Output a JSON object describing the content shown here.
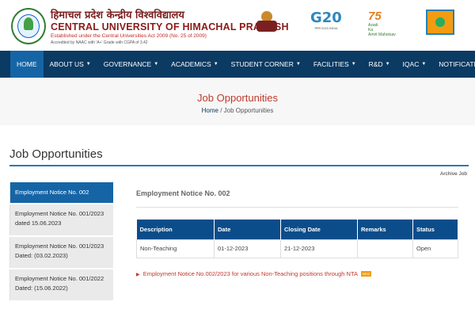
{
  "header": {
    "title_hindi": "हिमाचल प्रदेश केन्द्रीय विश्वविद्यालय",
    "title_en": "CENTRAL UNIVERSITY OF HIMACHAL PRADESH",
    "established": "Established under the Central Universities Act 2009 (No. 25 of 2009)",
    "accreditation": "Accredited by NAAC with 'A+' Grade with CGPA of 3.42",
    "g20": "G20",
    "g20_sub": "भारत 2023 INDIA",
    "azadi_num": "75",
    "azadi_line1": "Azadi",
    "azadi_line2": "Ka",
    "azadi_line3": "Amrit Mahotsav"
  },
  "nav": {
    "items": [
      "HOME",
      "ABOUT US",
      "GOVERNANCE",
      "ACADEMICS",
      "STUDENT CORNER",
      "FACILITIES",
      "R&D",
      "IQAC",
      "NOTIFICATION"
    ]
  },
  "banner": {
    "title": "Job Opportunities",
    "crumb_home": "Home",
    "crumb_sep": "/",
    "crumb_current": "Job Opportunities"
  },
  "section": {
    "title": "Job Opportunities",
    "archive": "Archive Job"
  },
  "sidebar": {
    "items": [
      {
        "label": "Employment Notice No. 002"
      },
      {
        "label": "Employment Notice No. 001/2023 dated 15.06.2023"
      },
      {
        "label": "Employment Notice No. 001/2023 Dated: (03.02.2023)"
      },
      {
        "label": "Employment Notice No. 001/2022 Dated: (15.06.2022)"
      }
    ]
  },
  "content": {
    "notice_title": "Employment Notice No. 002",
    "table": {
      "headers": [
        "Description",
        "Date",
        "Closing Date",
        "Remarks",
        "Status"
      ],
      "rows": [
        [
          "Non-Teaching",
          "01-12-2023",
          "21-12-2023",
          "",
          "Open"
        ]
      ]
    },
    "link_text": "Employment Notice No.002/2023 for various Non-Teaching positions through NTA",
    "new_badge": "NEW"
  },
  "colors": {
    "nav_bg": "#0b3a63",
    "nav_active": "#1565a6",
    "accent_red": "#c0392b",
    "table_header": "#0b4d8a"
  }
}
